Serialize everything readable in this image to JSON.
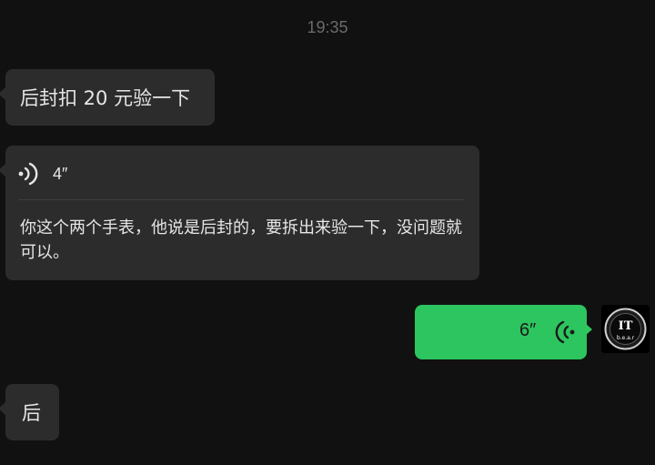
{
  "timestamp": "19:35",
  "messages": [
    {
      "direction": "incoming",
      "type": "text",
      "text": "后封扣 20 元验一下"
    },
    {
      "direction": "incoming",
      "type": "voice",
      "duration": "4″",
      "transcript": "你这个两个手表，他说是后封的，要拆出来验一下，没问题就可以。"
    },
    {
      "direction": "outgoing",
      "type": "voice",
      "duration": "6″"
    },
    {
      "direction": "incoming",
      "type": "text",
      "text": "后"
    }
  ],
  "avatar": {
    "line1": "IT",
    "line2": "b.e.a.r"
  },
  "colors": {
    "background": "#111111",
    "incoming_bubble": "#2c2c2c",
    "outgoing_bubble": "#2dc55f"
  },
  "icons": {
    "voice_incoming": "voice-wave-icon",
    "voice_outgoing": "voice-wave-icon"
  }
}
